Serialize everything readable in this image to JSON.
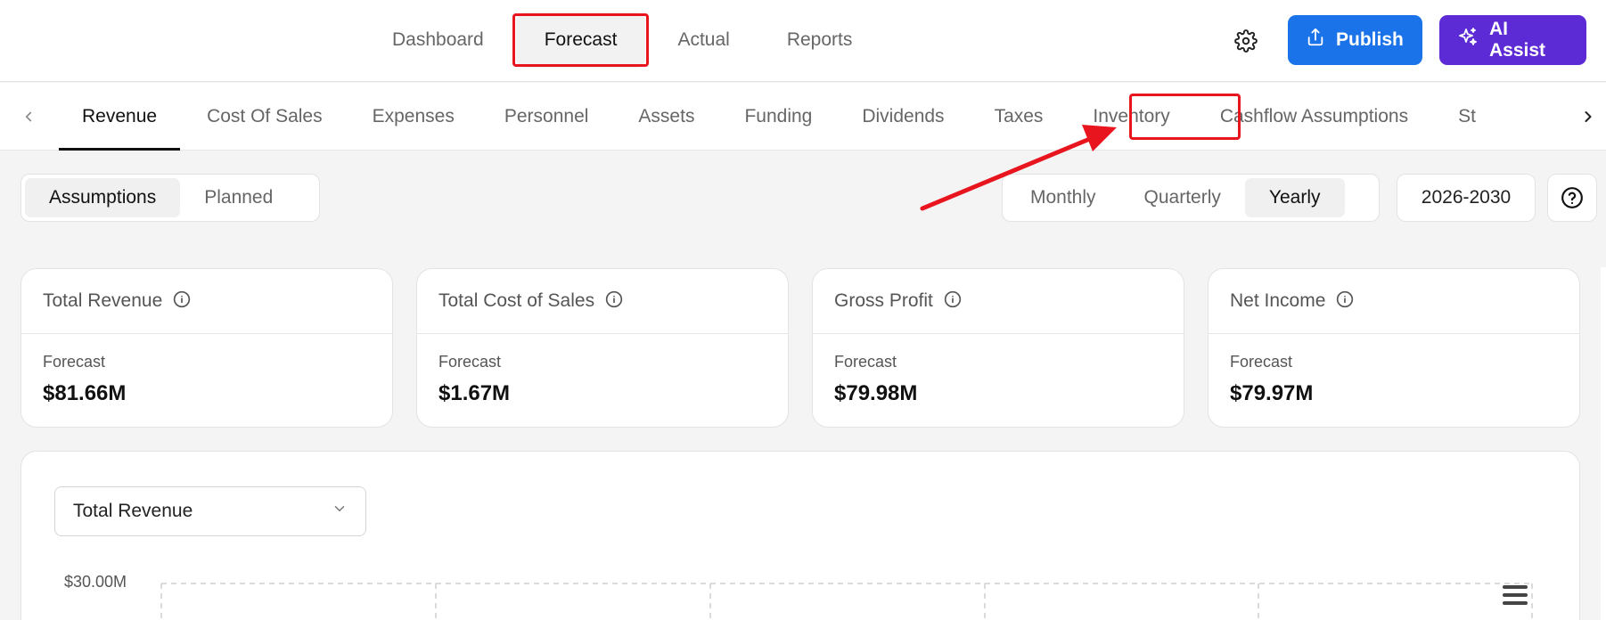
{
  "topnav": {
    "items": [
      {
        "label": "Dashboard"
      },
      {
        "label": "Forecast"
      },
      {
        "label": "Actual"
      },
      {
        "label": "Reports"
      }
    ],
    "active_index": 1
  },
  "actions": {
    "settings_icon": "gear-icon",
    "publish_label": "Publish",
    "ai_label": "AI Assist"
  },
  "subtabs": {
    "items": [
      {
        "label": "Revenue"
      },
      {
        "label": "Cost Of Sales"
      },
      {
        "label": "Expenses"
      },
      {
        "label": "Personnel"
      },
      {
        "label": "Assets"
      },
      {
        "label": "Funding"
      },
      {
        "label": "Dividends"
      },
      {
        "label": "Taxes"
      },
      {
        "label": "Inventory"
      },
      {
        "label": "Cashflow Assumptions"
      },
      {
        "label": "St"
      }
    ],
    "active_index": 0
  },
  "view_toggle": {
    "options": [
      {
        "label": "Assumptions"
      },
      {
        "label": "Planned"
      }
    ],
    "selected": "Assumptions"
  },
  "period_toggle": {
    "options": [
      {
        "label": "Monthly"
      },
      {
        "label": "Quarterly"
      },
      {
        "label": "Yearly"
      }
    ],
    "selected": "Yearly"
  },
  "period_range": "2026-2030",
  "cards": [
    {
      "title": "Total Revenue",
      "sub": "Forecast",
      "value": "$81.66M"
    },
    {
      "title": "Total Cost of Sales",
      "sub": "Forecast",
      "value": "$1.67M"
    },
    {
      "title": "Gross Profit",
      "sub": "Forecast",
      "value": "$79.98M"
    },
    {
      "title": "Net Income",
      "sub": "Forecast",
      "value": "$79.97M"
    }
  ],
  "chart": {
    "metric_select": "Total Revenue",
    "y_top_label": "$30.00M"
  },
  "colors": {
    "publish": "#1a73e8",
    "ai_assist": "#5c2bd6",
    "annotation": "#e8141e"
  }
}
